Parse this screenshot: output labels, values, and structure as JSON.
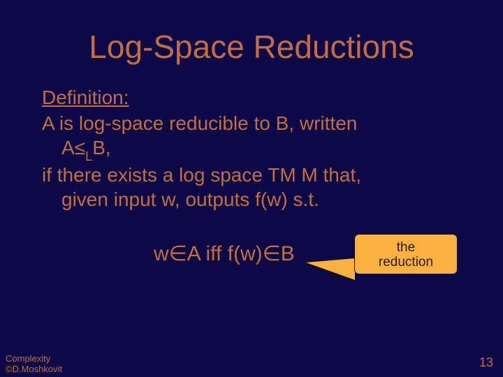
{
  "title": "Log-Space Reductions",
  "definition_label": "Definition:",
  "line1": "A is log-space reducible to B, written",
  "line2_pre": "A",
  "line2_rel": "≤",
  "line2_sub": "L",
  "line2_post": "B,",
  "line3": "if there exists a log space TM M that,",
  "line4": "given input w, outputs f(w) s.t.",
  "formula": "w∈A iff f(w)∈B",
  "callout_line1": "the",
  "callout_line2": "reduction",
  "footer_line1": "Complexity",
  "footer_line2": "©D.Moshkovit",
  "page_number": "13"
}
